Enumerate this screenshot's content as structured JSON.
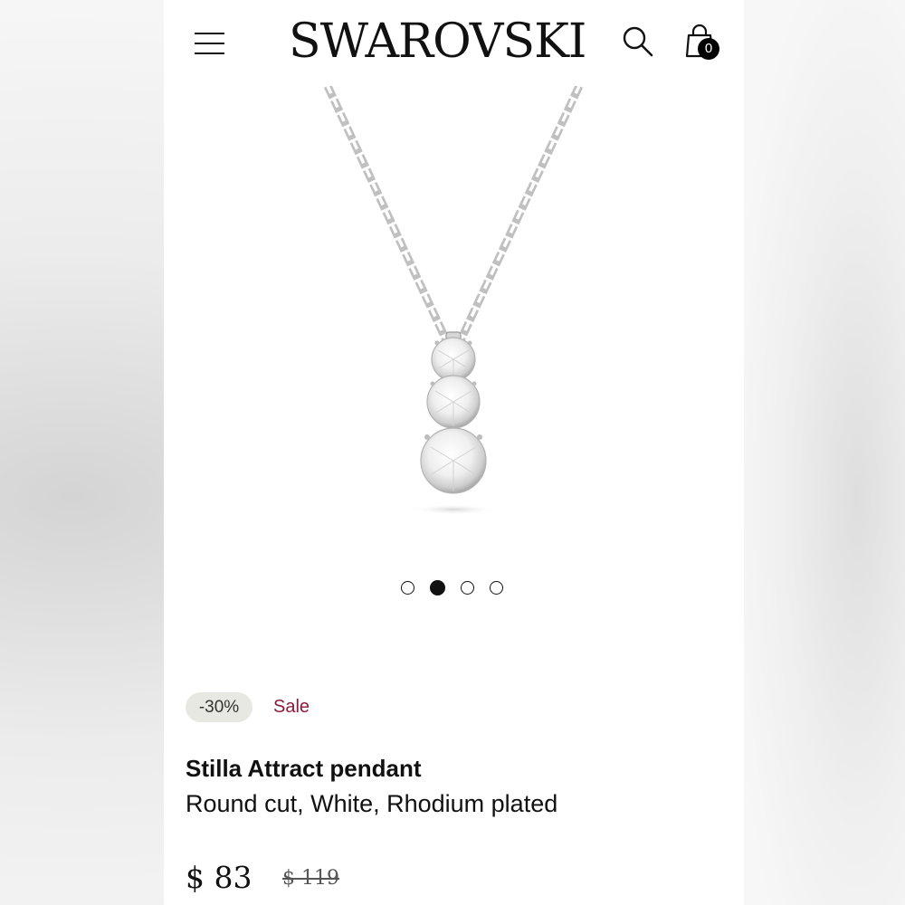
{
  "header": {
    "brand": "SWAROVSKI",
    "cart_count": "0",
    "icons": [
      "menu-icon",
      "search-icon",
      "shopping-bag-icon"
    ]
  },
  "gallery": {
    "slides": 4,
    "active_slide": 2
  },
  "product": {
    "discount_badge": "-30%",
    "sale_label": "Sale",
    "name": "Stilla Attract pendant",
    "description": "Round cut, White, Rhodium plated",
    "price": "$ 83",
    "original_price": "$ 119"
  },
  "colors": {
    "sale": "#8a1c3a",
    "badge_bg": "#e8e8e2",
    "text": "#111111"
  }
}
